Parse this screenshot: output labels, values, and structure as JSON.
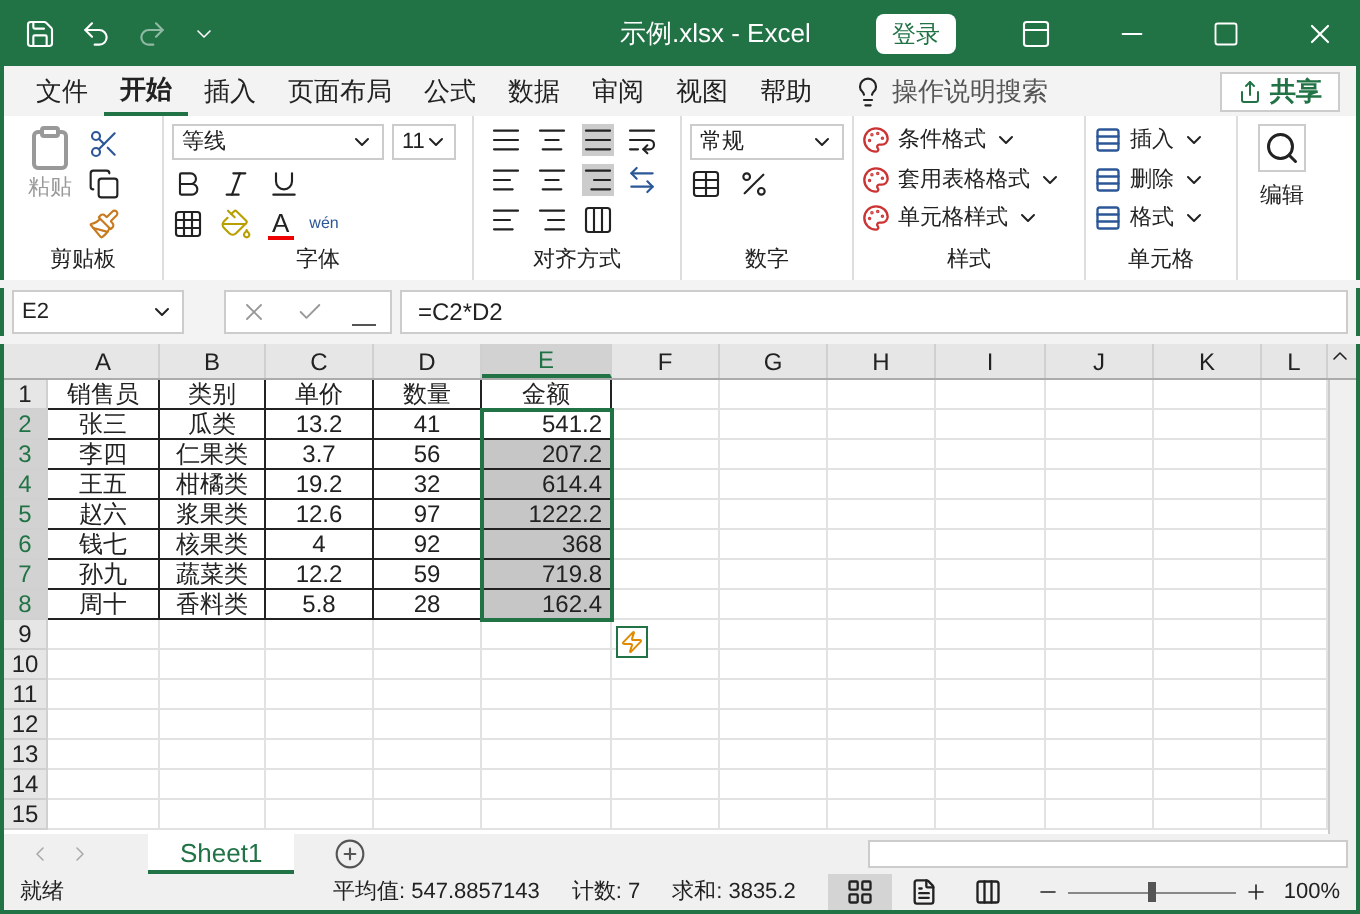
{
  "window": {
    "title": "示例.xlsx  -  Excel",
    "login": "登录"
  },
  "tabs": [
    {
      "label": "文件",
      "selected": false
    },
    {
      "label": "开始",
      "selected": true
    },
    {
      "label": "插入",
      "selected": false
    },
    {
      "label": "页面布局",
      "selected": false
    },
    {
      "label": "公式",
      "selected": false
    },
    {
      "label": "数据",
      "selected": false
    },
    {
      "label": "审阅",
      "selected": false
    },
    {
      "label": "视图",
      "selected": false
    },
    {
      "label": "帮助",
      "selected": false
    }
  ],
  "tell_me": {
    "placeholder": "操作说明搜索"
  },
  "share": "共享",
  "ribbon": {
    "clipboard": {
      "paste": "粘贴",
      "label": "剪贴板"
    },
    "font": {
      "name": "等线",
      "size": "11",
      "label": "字体",
      "phonetic": "wén",
      "color_glyph": "A"
    },
    "alignment": {
      "label": "对齐方式"
    },
    "number": {
      "format": "常规",
      "label": "数字"
    },
    "styles": {
      "items": [
        "条件格式",
        "套用表格格式",
        "单元格样式"
      ],
      "label": "样式"
    },
    "cells": {
      "items": [
        "插入",
        "删除",
        "格式"
      ],
      "label": "单元格"
    },
    "editing": {
      "label": "编辑"
    }
  },
  "formula_bar": {
    "name_box": "E2",
    "formula": "=C2*D2"
  },
  "sheet": {
    "columns": [
      {
        "label": "A",
        "selected": false
      },
      {
        "label": "B",
        "selected": false
      },
      {
        "label": "C",
        "selected": false
      },
      {
        "label": "D",
        "selected": false
      },
      {
        "label": "E",
        "selected": true
      },
      {
        "label": "F",
        "selected": false
      },
      {
        "label": "G",
        "selected": false
      },
      {
        "label": "H",
        "selected": false
      },
      {
        "label": "I",
        "selected": false
      },
      {
        "label": "J",
        "selected": false
      },
      {
        "label": "K",
        "selected": false
      },
      {
        "label": "L",
        "selected": false
      }
    ],
    "rows": [
      {
        "number": "1",
        "selected": false,
        "cells": [
          "销售员",
          "类别",
          "单价",
          "数量",
          "金额"
        ]
      },
      {
        "number": "2",
        "selected": true,
        "cells": [
          "张三",
          "瓜类",
          "13.2",
          "41",
          "541.2"
        ]
      },
      {
        "number": "3",
        "selected": true,
        "cells": [
          "李四",
          "仁果类",
          "3.7",
          "56",
          "207.2"
        ]
      },
      {
        "number": "4",
        "selected": true,
        "cells": [
          "王五",
          "柑橘类",
          "19.2",
          "32",
          "614.4"
        ]
      },
      {
        "number": "5",
        "selected": true,
        "cells": [
          "赵六",
          "浆果类",
          "12.6",
          "97",
          "1222.2"
        ]
      },
      {
        "number": "6",
        "selected": true,
        "cells": [
          "钱七",
          "核果类",
          "4",
          "92",
          "368"
        ]
      },
      {
        "number": "7",
        "selected": true,
        "cells": [
          "孙九",
          "蔬菜类",
          "12.2",
          "59",
          "719.8"
        ]
      },
      {
        "number": "8",
        "selected": true,
        "cells": [
          "周十",
          "香料类",
          "5.8",
          "28",
          "162.4"
        ]
      },
      {
        "number": "9",
        "selected": false,
        "cells": []
      },
      {
        "number": "10",
        "selected": false,
        "cells": []
      },
      {
        "number": "11",
        "selected": false,
        "cells": []
      },
      {
        "number": "12",
        "selected": false,
        "cells": []
      },
      {
        "number": "13",
        "selected": false,
        "cells": []
      },
      {
        "number": "14",
        "selected": false,
        "cells": []
      },
      {
        "number": "15",
        "selected": false,
        "cells": []
      }
    ]
  },
  "sheet_tabs": [
    {
      "label": "Sheet1",
      "selected": true
    }
  ],
  "status_bar": {
    "state": "就绪",
    "average": "平均值: 547.8857143",
    "count": "计数: 7",
    "sum": "求和: 3835.2",
    "views": [
      {
        "kind": "normal",
        "selected": true
      },
      {
        "kind": "page_layout",
        "selected": false
      },
      {
        "kind": "page_break",
        "selected": false
      }
    ],
    "zoom": {
      "level": 0.5,
      "reading": "100%"
    }
  }
}
